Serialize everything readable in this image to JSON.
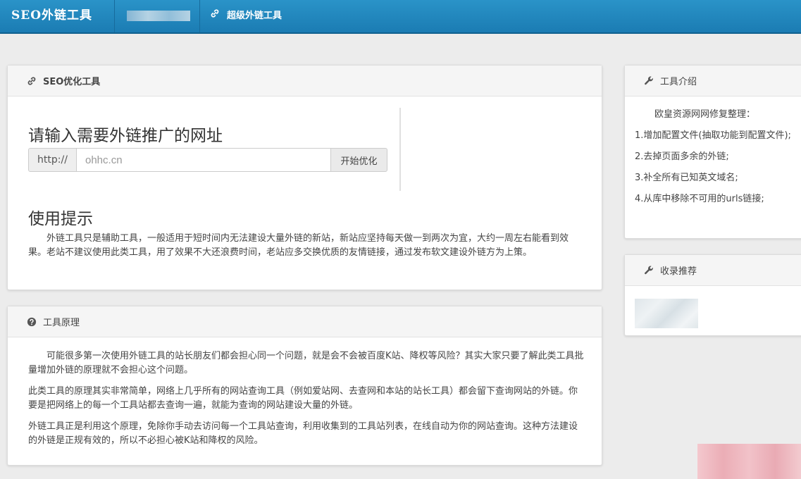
{
  "nav": {
    "brand": "SEO外链工具",
    "link_label": "超级外链工具"
  },
  "seo_panel": {
    "title": "SEO优化工具",
    "form_title": "请输入需要外链推广的网址",
    "protocol": "http://",
    "url_value": "ohhc.cn",
    "submit_label": "开始优化",
    "tips_title": "使用提示",
    "tips_text": "外链工具只是辅助工具，一般适用于短时间内无法建设大量外链的新站，新站应坚持每天做一到两次为宜，大约一周左右能看到效果。老站不建议使用此类工具，用了效果不大还浪费时间，老站应多交换优质的友情链接，通过发布软文建设外链方为上策。"
  },
  "principle_panel": {
    "title": "工具原理",
    "paragraphs": [
      "可能很多第一次使用外链工具的站长朋友们都会担心同一个问题，就是会不会被百度K站、降权等风险？其实大家只要了解此类工具批量增加外链的原理就不会担心这个问题。",
      "此类工具的原理其实非常简单，网络上几乎所有的网站查询工具（例如爱站网、去查网和本站的站长工具）都会留下查询网站的外链。你要是把网络上的每一个工具站都去查询一遍，就能为查询的网站建设大量的外链。",
      "外链工具正是利用这个原理，免除你手动去访问每一个工具站查询，利用收集到的工具站列表，在线自动为你的网站查询。这种方法建设的外链是正规有效的，所以不必担心被K站和降权的风险。"
    ]
  },
  "intro_panel": {
    "title": "工具介绍",
    "lead": "欧皇资源网网修复整理：",
    "items": [
      "1.增加配置文件(抽取功能到配置文件);",
      "2.去掉页面多余的外链;",
      "3.补全所有已知英文域名;",
      "4.从库中移除不可用的urls链接;"
    ]
  },
  "record_panel": {
    "title": "收录推荐"
  },
  "icons": {
    "link": "link-icon",
    "question": "question-circle-icon",
    "wrench": "wrench-icon"
  },
  "colors": {
    "navbar": "#1f86bd",
    "panel_heading": "#f5f5f5",
    "page_bg": "#ececec"
  }
}
